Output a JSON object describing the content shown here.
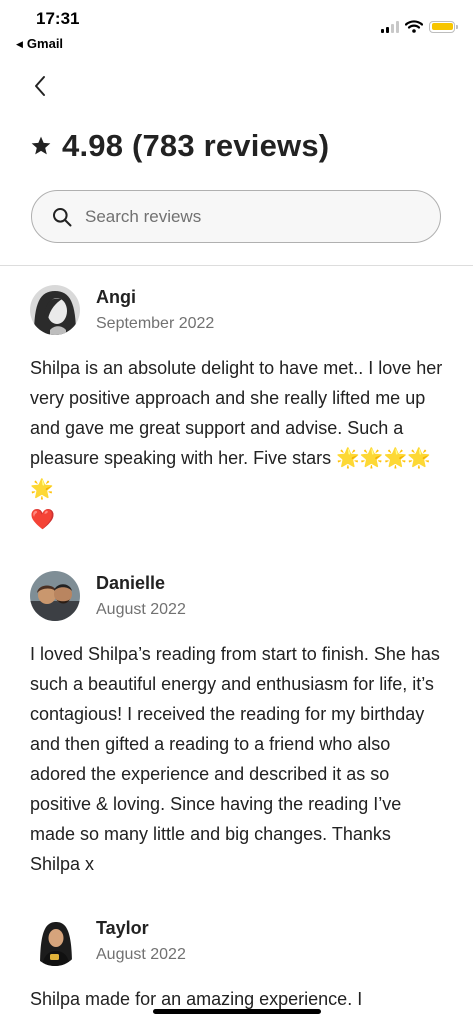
{
  "status_bar": {
    "time": "17:31",
    "back_app": "Gmail"
  },
  "header": {
    "title": "4.98 (783 reviews)"
  },
  "search": {
    "placeholder": "Search reviews"
  },
  "reviews": [
    {
      "name": "Angi",
      "date": "September 2022",
      "text": "Shilpa is an absolute delight to have met.. I love her very positive approach and she really lifted me up and gave me great support and advise. Such a pleasure speaking with her. Five stars",
      "emojis": "🌟🌟🌟🌟🌟",
      "heart": "❤️"
    },
    {
      "name": "Danielle",
      "date": "August 2022",
      "text": "I loved Shilpa’s reading from start to finish. She has such a beautiful energy and enthusiasm for life, it’s contagious! I received the reading for my birthday and then gifted a reading to a friend who also adored the experience and described it as so positive & loving. Since having the reading I’ve made so many little and big changes. Thanks Shilpa x"
    },
    {
      "name": "Taylor",
      "date": "August 2022",
      "text": "Shilpa made for an amazing experience. I"
    }
  ],
  "colors": {
    "accent": "#222222",
    "muted": "#717171",
    "battery": "#f7c500"
  }
}
